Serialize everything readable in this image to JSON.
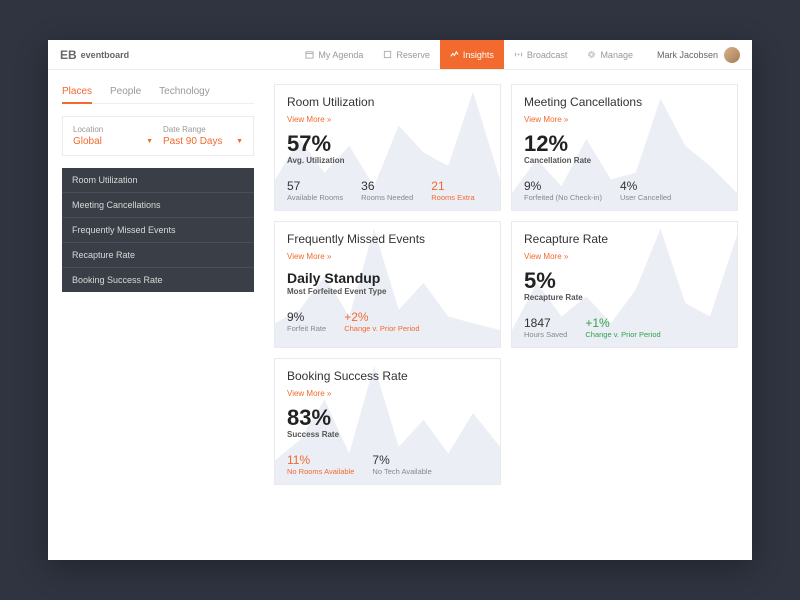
{
  "brand": "eventboard",
  "nav": [
    {
      "icon": "calendar",
      "label": "My Agenda"
    },
    {
      "icon": "reserve",
      "label": "Reserve"
    },
    {
      "icon": "chart",
      "label": "Insights",
      "active": true
    },
    {
      "icon": "broadcast",
      "label": "Broadcast"
    },
    {
      "icon": "gear",
      "label": "Manage"
    }
  ],
  "user": {
    "name": "Mark Jacobsen"
  },
  "sideTabs": [
    "Places",
    "People",
    "Technology"
  ],
  "filters": {
    "location": {
      "label": "Location",
      "value": "Global"
    },
    "range": {
      "label": "Date Range",
      "value": "Past 90 Days"
    }
  },
  "sideNav": [
    "Room Utilization",
    "Meeting Cancellations",
    "Frequently Missed Events",
    "Recapture Rate",
    "Booking Success Rate"
  ],
  "viewMore": "View More »",
  "cards": {
    "util": {
      "title": "Room Utilization",
      "big": "57%",
      "sub": "Avg. Utilization",
      "s1v": "57",
      "s1l": "Available Rooms",
      "s2v": "36",
      "s2l": "Rooms Needed",
      "s3v": "21",
      "s3l": "Rooms Extra"
    },
    "cancel": {
      "title": "Meeting Cancellations",
      "big": "12%",
      "sub": "Cancellation Rate",
      "s1v": "9%",
      "s1l": "Forfeited (No Check-in)",
      "s2v": "4%",
      "s2l": "User Cancelled"
    },
    "missed": {
      "title": "Frequently Missed Events",
      "bigtext": "Daily Standup",
      "sub": "Most Forfeited Event Type",
      "s1v": "9%",
      "s1l": "Forfeit Rate",
      "s2v": "+2%",
      "s2l": "Change v. Prior Period"
    },
    "recap": {
      "title": "Recapture Rate",
      "big": "5%",
      "sub": "Recapture Rate",
      "s1v": "1847",
      "s1l": "Hours Saved",
      "s2v": "+1%",
      "s2l": "Change v. Prior Period"
    },
    "booking": {
      "title": "Booking Success Rate",
      "big": "83%",
      "sub": "Success Rate",
      "s1v": "11%",
      "s1l": "No Rooms Available",
      "s2v": "7%",
      "s2l": "No Tech Available"
    }
  },
  "chart_data": [
    {
      "type": "area",
      "title": "Room Utilization",
      "ylabel": "Avg. Utilization",
      "ylim": [
        0,
        100
      ],
      "values": [
        30,
        60,
        35,
        55,
        25,
        70,
        50,
        40,
        95,
        30
      ]
    },
    {
      "type": "area",
      "title": "Meeting Cancellations",
      "ylabel": "Cancellation Rate",
      "ylim": [
        0,
        100
      ],
      "values": [
        20,
        45,
        25,
        60,
        30,
        35,
        90,
        55,
        40,
        20
      ]
    },
    {
      "type": "area",
      "title": "Frequently Missed Events",
      "ylabel": "Forfeit Rate",
      "ylim": [
        0,
        100
      ],
      "values": [
        25,
        35,
        60,
        30,
        95,
        35,
        55,
        30,
        25,
        20
      ]
    },
    {
      "type": "area",
      "title": "Recapture Rate",
      "ylabel": "Recapture Rate",
      "ylim": [
        0,
        100
      ],
      "values": [
        20,
        55,
        30,
        45,
        25,
        50,
        95,
        40,
        30,
        90
      ]
    },
    {
      "type": "area",
      "title": "Booking Success Rate",
      "ylabel": "Success Rate",
      "ylim": [
        0,
        100
      ],
      "values": [
        25,
        40,
        70,
        30,
        95,
        35,
        55,
        30,
        60,
        35
      ]
    }
  ]
}
